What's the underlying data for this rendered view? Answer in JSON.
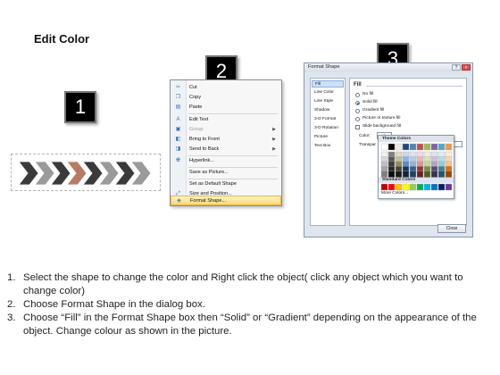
{
  "title": "Edit Color",
  "badges": [
    "1",
    "2",
    "3"
  ],
  "context_menu": {
    "items": [
      {
        "label": "Cut",
        "icon": "scissors-icon",
        "enabled": true
      },
      {
        "label": "Copy",
        "icon": "copy-icon",
        "enabled": true
      },
      {
        "label": "Paste",
        "icon": "paste-icon",
        "enabled": true
      },
      {
        "label": "Edit Text",
        "icon": "edit-text-icon",
        "enabled": true
      },
      {
        "label": "Group",
        "icon": "group-icon",
        "enabled": false,
        "submenu": true
      },
      {
        "label": "Bring to Front",
        "icon": "bring-front-icon",
        "enabled": true,
        "submenu": true
      },
      {
        "label": "Send to Back",
        "icon": "send-back-icon",
        "enabled": true,
        "submenu": true
      },
      {
        "label": "Hyperlink...",
        "icon": "hyperlink-icon",
        "enabled": true
      },
      {
        "label": "Save as Picture...",
        "icon": "",
        "enabled": true
      },
      {
        "label": "Set as Default Shape",
        "icon": "",
        "enabled": true
      },
      {
        "label": "Size and Position...",
        "icon": "size-icon",
        "enabled": true
      },
      {
        "label": "Format Shape...",
        "icon": "format-shape-icon",
        "enabled": true,
        "highlighted": true
      }
    ]
  },
  "dialog": {
    "title": "Format Shape",
    "help": "?",
    "close_glyph": "×",
    "nav": [
      "Fill",
      "Line Color",
      "Line Style",
      "Shadow",
      "3-D Format",
      "3-D Rotation",
      "Picture",
      "Text Box"
    ],
    "section": "Fill",
    "options": [
      {
        "label": "No fill",
        "selected": false
      },
      {
        "label": "Solid fill",
        "selected": true
      },
      {
        "label": "Gradient fill",
        "selected": false
      },
      {
        "label": "Picture or texture fill",
        "selected": false
      }
    ],
    "slide_bg": "Slide background fill",
    "color_label": "Color:",
    "transparency_label": "Transpar",
    "close_button": "Close"
  },
  "palette": {
    "theme_title": "Theme Colors",
    "standard_title": "Standard Colors",
    "more": "More Colors...",
    "theme_top": [
      "#ffffff",
      "#000000",
      "#eeece1",
      "#1f497d",
      "#4f81bd",
      "#c0504d",
      "#9bbb59",
      "#8064a2",
      "#4bacc6",
      "#f79646"
    ],
    "theme_shades": [
      [
        "#f2f2f2",
        "#7f7f7f",
        "#ddd9c3",
        "#c6d9f0",
        "#dbe5f1",
        "#f2dcdb",
        "#ebf1dd",
        "#e5e0ec",
        "#dbeef3",
        "#fdeada"
      ],
      [
        "#d8d8d8",
        "#595959",
        "#c4bd97",
        "#8db3e2",
        "#b8cce4",
        "#e5b9b7",
        "#d7e3bc",
        "#ccc1d9",
        "#b7dde8",
        "#fbd5b5"
      ],
      [
        "#bfbfbf",
        "#3f3f3f",
        "#938953",
        "#548dd4",
        "#95b3d7",
        "#d99694",
        "#c3d69b",
        "#b2a2c7",
        "#92cddc",
        "#fac08f"
      ],
      [
        "#a5a5a5",
        "#262626",
        "#494429",
        "#17365d",
        "#366092",
        "#953734",
        "#76923c",
        "#5f497a",
        "#31859b",
        "#e36c09"
      ],
      [
        "#7f7f7f",
        "#0c0c0c",
        "#1d1b10",
        "#0f243e",
        "#244061",
        "#632423",
        "#4f6128",
        "#3f3151",
        "#205867",
        "#974806"
      ]
    ],
    "standard": [
      "#c00000",
      "#ff0000",
      "#ffc000",
      "#ffff00",
      "#92d050",
      "#00b050",
      "#00b0f0",
      "#0070c0",
      "#002060",
      "#7030a0"
    ]
  },
  "instructions": [
    {
      "num": "1.",
      "text": "Select the shape to change the color and Right click the object( click any object which you want to change color)"
    },
    {
      "num": "2.",
      "text": "Choose Format Shape in the dialog box."
    },
    {
      "num": "3.",
      "text": "Choose “Fill” in the Format Shape box then “Solid” or “Gradient” depending on the appearance of the object. Change colour as shown in the picture."
    }
  ],
  "colors": {
    "arrow_dark": "#3a3a3a",
    "arrow_light": "#9a9a9a",
    "arrow_accent": "#b87a64",
    "highlight": "#fbd875"
  }
}
